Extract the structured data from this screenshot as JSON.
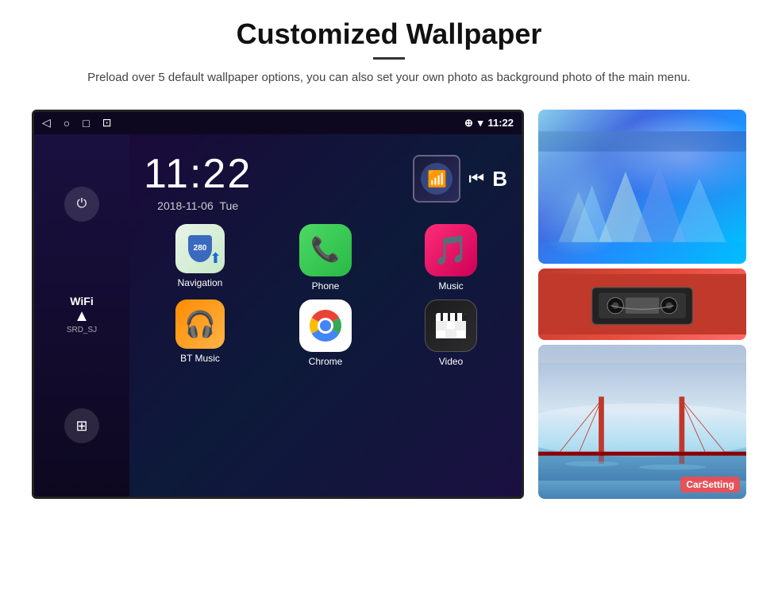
{
  "header": {
    "title": "Customized Wallpaper",
    "subtitle": "Preload over 5 default wallpaper options, you can also set your own photo as background photo of the main menu."
  },
  "screen": {
    "status_bar": {
      "time": "11:22",
      "icons_left": [
        "◁",
        "○",
        "□",
        "⊡"
      ],
      "icons_right": [
        "⊕",
        "▾"
      ]
    },
    "clock": {
      "time": "11:22",
      "date": "2018-11-06",
      "day": "Tue"
    },
    "sidebar": {
      "power_label": "⏻",
      "wifi_label": "WiFi",
      "wifi_signal": "▲",
      "wifi_ssid": "SRD_SJ",
      "apps_label": "⊞"
    },
    "apps": [
      {
        "id": "navigation",
        "label": "Navigation",
        "icon_type": "navigation"
      },
      {
        "id": "phone",
        "label": "Phone",
        "icon_type": "phone"
      },
      {
        "id": "music",
        "label": "Music",
        "icon_type": "music"
      },
      {
        "id": "bt-music",
        "label": "BT Music",
        "icon_type": "bt-music"
      },
      {
        "id": "chrome",
        "label": "Chrome",
        "icon_type": "chrome"
      },
      {
        "id": "video",
        "label": "Video",
        "icon_type": "video"
      }
    ],
    "navigation_badge": "280"
  },
  "wallpapers": [
    {
      "id": "ice",
      "type": "ice",
      "label": ""
    },
    {
      "id": "cassette",
      "type": "cassette",
      "label": ""
    },
    {
      "id": "bridge",
      "type": "bridge",
      "label": "CarSetting"
    }
  ]
}
